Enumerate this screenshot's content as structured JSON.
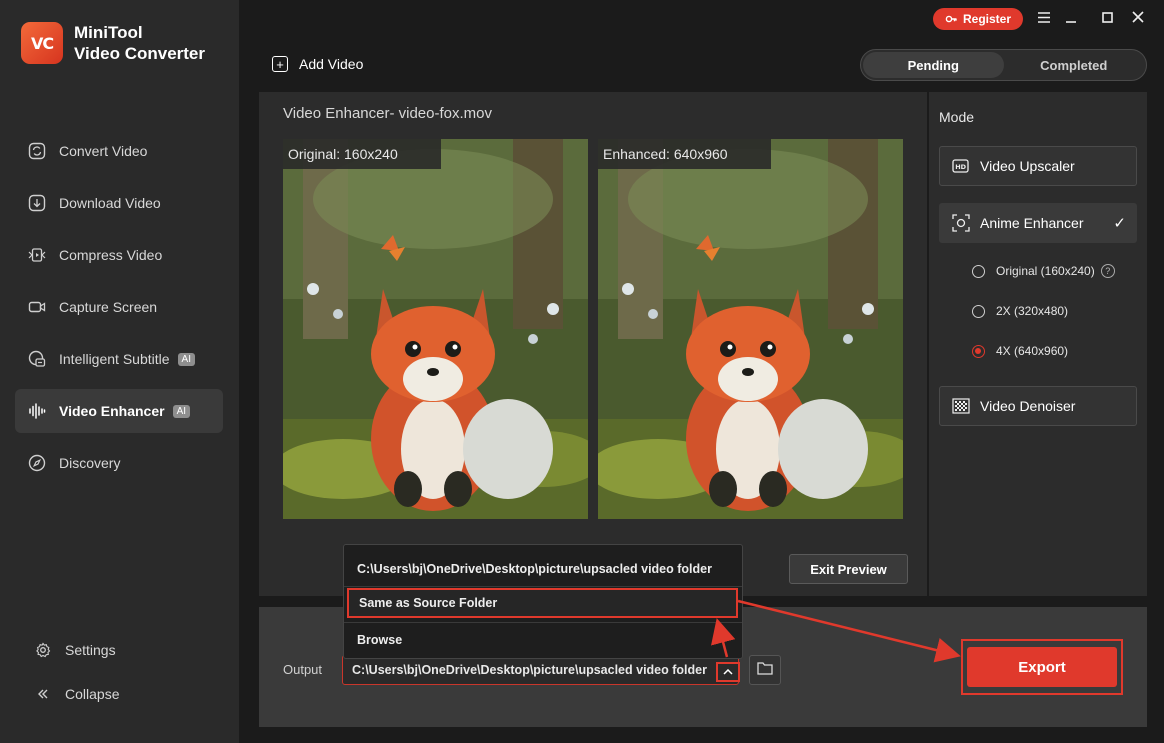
{
  "app": {
    "name_line1": "MiniTool",
    "name_line2": "Video Converter",
    "logo_text": "VC"
  },
  "sidebar": {
    "items": [
      {
        "label": "Convert Video",
        "icon": "convert-icon"
      },
      {
        "label": "Download Video",
        "icon": "download-icon"
      },
      {
        "label": "Compress Video",
        "icon": "compress-icon"
      },
      {
        "label": "Capture Screen",
        "icon": "camera-icon"
      },
      {
        "label": "Intelligent Subtitle",
        "icon": "subtitle-icon",
        "badge": "AI"
      },
      {
        "label": "Video Enhancer",
        "icon": "waveform-icon",
        "badge": "AI",
        "active": true
      },
      {
        "label": "Discovery",
        "icon": "compass-icon"
      }
    ],
    "settings": "Settings",
    "collapse": "Collapse"
  },
  "topbar": {
    "register": "Register",
    "add_video": "Add Video"
  },
  "tabs": {
    "pending": "Pending",
    "completed": "Completed"
  },
  "preview": {
    "title": "Video Enhancer- video-fox.mov",
    "original_label": "Original: 160x240",
    "enhanced_label": "Enhanced: 640x960",
    "exit_preview": "Exit Preview"
  },
  "mode": {
    "title": "Mode",
    "video_upscaler": "Video Upscaler",
    "anime_enhancer": "Anime Enhancer",
    "options": [
      {
        "label": "Original (160x240)",
        "selected": false
      },
      {
        "label": "2X (320x480)",
        "selected": false
      },
      {
        "label": "4X (640x960)",
        "selected": true
      }
    ],
    "video_denoiser": "Video Denoiser"
  },
  "output": {
    "label": "Output",
    "path": "C:\\Users\\bj\\OneDrive\\Desktop\\picture\\upsacled video folder",
    "export": "Export"
  },
  "dropdown": {
    "items": [
      "C:\\Users\\bj\\OneDrive\\Desktop\\picture\\upsacled video folder",
      "Same as Source Folder",
      "Browse"
    ]
  },
  "colors": {
    "accent": "#e0392c",
    "sidebar_bg": "#2a2a2a",
    "panel_bg": "#2c2c2c",
    "app_bg": "#1b1b1b"
  }
}
